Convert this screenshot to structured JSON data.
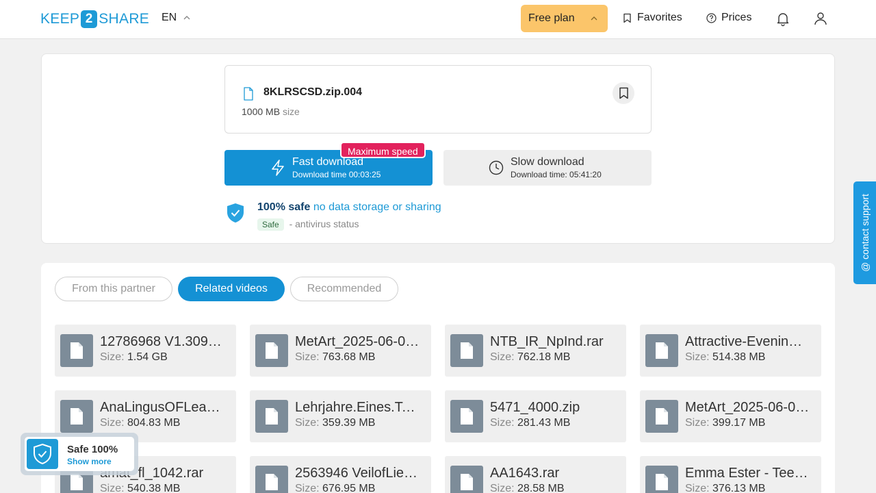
{
  "header": {
    "logo_left": "KEEP",
    "logo_mid": "2",
    "logo_right": "SHARE",
    "language": "EN",
    "free_plan": "Free plan",
    "favorites": "Favorites",
    "prices": "Prices"
  },
  "file": {
    "name": "8KLRSCSD.zip.004",
    "size_value": "1000 MB",
    "size_label": "size"
  },
  "download": {
    "fast_title": "Fast download",
    "fast_time": "Download time 00:03:25",
    "badge": "Maximum speed",
    "slow_title": "Slow download",
    "slow_time": "Download time: 05:41:20"
  },
  "safety": {
    "bold": "100% safe",
    "rest": "no data storage or sharing",
    "tag": "Safe",
    "status": "- antivirus status"
  },
  "tabs": [
    {
      "label": "From this partner",
      "active": false
    },
    {
      "label": "Related videos",
      "active": true
    },
    {
      "label": "Recommended",
      "active": false
    }
  ],
  "size_label": "Size:",
  "items": [
    {
      "name": "12786968 V1.309…",
      "size": "1.54 GB"
    },
    {
      "name": "MetArt_2025-06-0…",
      "size": "763.68 MB"
    },
    {
      "name": "NTB_IR_NpInd.rar",
      "size": "762.18 MB"
    },
    {
      "name": "Attractive-Evenin…",
      "size": "514.38 MB"
    },
    {
      "name": "AnaLingusOFLeak…",
      "size": "804.83 MB"
    },
    {
      "name": "Lehrjahre.Eines.Te…",
      "size": "359.39 MB"
    },
    {
      "name": "5471_4000.zip",
      "size": "281.43 MB"
    },
    {
      "name": "MetArt_2025-06-0…",
      "size": "399.17 MB"
    },
    {
      "name": "amat_fl_1042.rar",
      "size": "540.38 MB"
    },
    {
      "name": "2563946 VeilofLie…",
      "size": "676.95 MB"
    },
    {
      "name": "AA1643.rar",
      "size": "28.58 MB"
    },
    {
      "name": "Emma Ester - Tee…",
      "size": "376.13 MB"
    }
  ],
  "support": "@ contact support",
  "safe_badge": {
    "title": "Safe 100%",
    "link": "Show more"
  },
  "colors": {
    "brand": "#1e9ad6",
    "primary_button": "#1491d4",
    "free_plan": "#fbc56a",
    "badge_red": "#e2225d"
  }
}
